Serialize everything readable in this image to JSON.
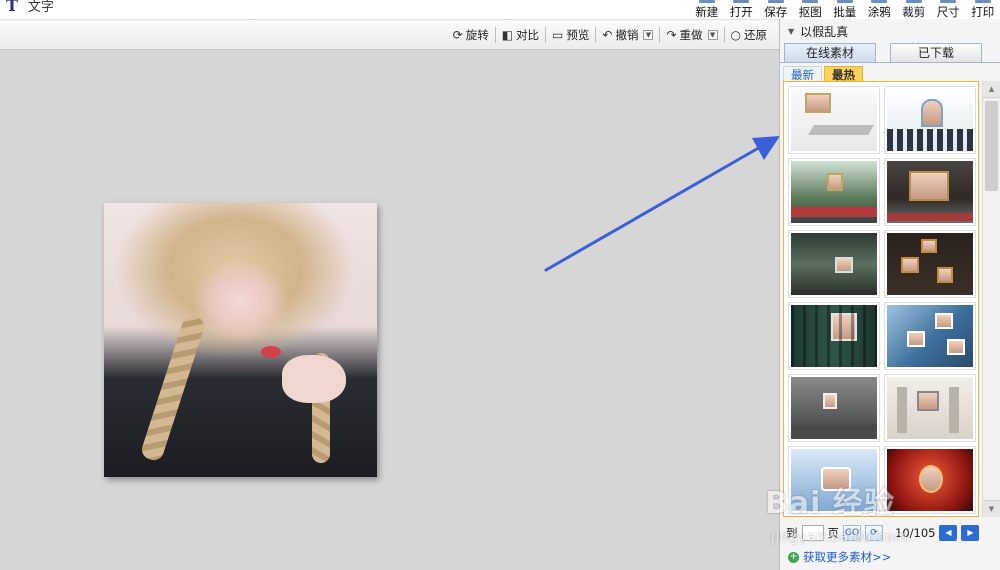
{
  "app": {
    "title_fragment": "文字"
  },
  "main_toolbar": [
    {
      "label": "新建"
    },
    {
      "label": "打开"
    },
    {
      "label": "保存"
    },
    {
      "label": "抠图"
    },
    {
      "label": "批量"
    },
    {
      "label": "涂鸦"
    },
    {
      "label": "裁剪"
    },
    {
      "label": "尺寸"
    },
    {
      "label": "打印"
    }
  ],
  "edit_toolbar": {
    "rotate": "旋转",
    "compare": "对比",
    "preview": "预览",
    "undo": "撤销",
    "redo": "重做",
    "restore": "还原"
  },
  "panel": {
    "title": "以假乱真",
    "tabs": [
      "在线素材",
      "已下载"
    ],
    "active_tab": 0,
    "subtabs": [
      "最新",
      "最热"
    ],
    "active_subtab": 1,
    "pager": {
      "prefix": "到",
      "suffix": "页",
      "go": "GO",
      "page_info": "10/105"
    },
    "more_link": "获取更多素材>>"
  },
  "watermark": {
    "text": "Bai 经验",
    "url": "jingyan.baidu.com"
  },
  "colors": {
    "accent": "#f0b33c",
    "arrow": "#3a5fd9",
    "link": "#1f5fcf"
  }
}
